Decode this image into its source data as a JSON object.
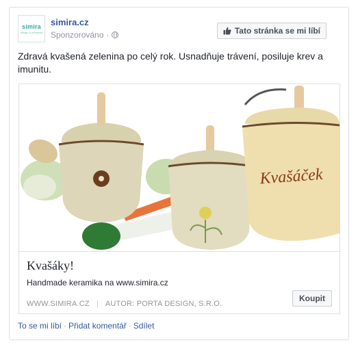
{
  "post": {
    "page_name": "simira.cz",
    "avatar_logo": "simira",
    "avatar_sub": "design & keramika",
    "sponsored_label": "Sponzorováno",
    "visibility_icon": "globe-icon",
    "like_page_label": "Tato stránka se mi líbí",
    "text": "Zdravá kvašená zelenina po celý rok. Usnadňuje trávení, posiluje krev a imunitu."
  },
  "photo": {
    "jar_label": "Kvašáček"
  },
  "link": {
    "title": "Kvašáky!",
    "description": "Handmade keramika na www.simira.cz",
    "domain": "WWW.SIMIRA.CZ",
    "separator": "|",
    "author": "AUTOR: PORTA DESIGN, S.R.O.",
    "cta_label": "Koupit"
  },
  "actions": {
    "like": "To se mi líbí",
    "comment": "Přidat komentář",
    "share": "Sdílet",
    "dot": "·"
  },
  "colors": {
    "link_blue": "#365899",
    "muted_gray": "#90949c",
    "border": "#dddfe2"
  }
}
